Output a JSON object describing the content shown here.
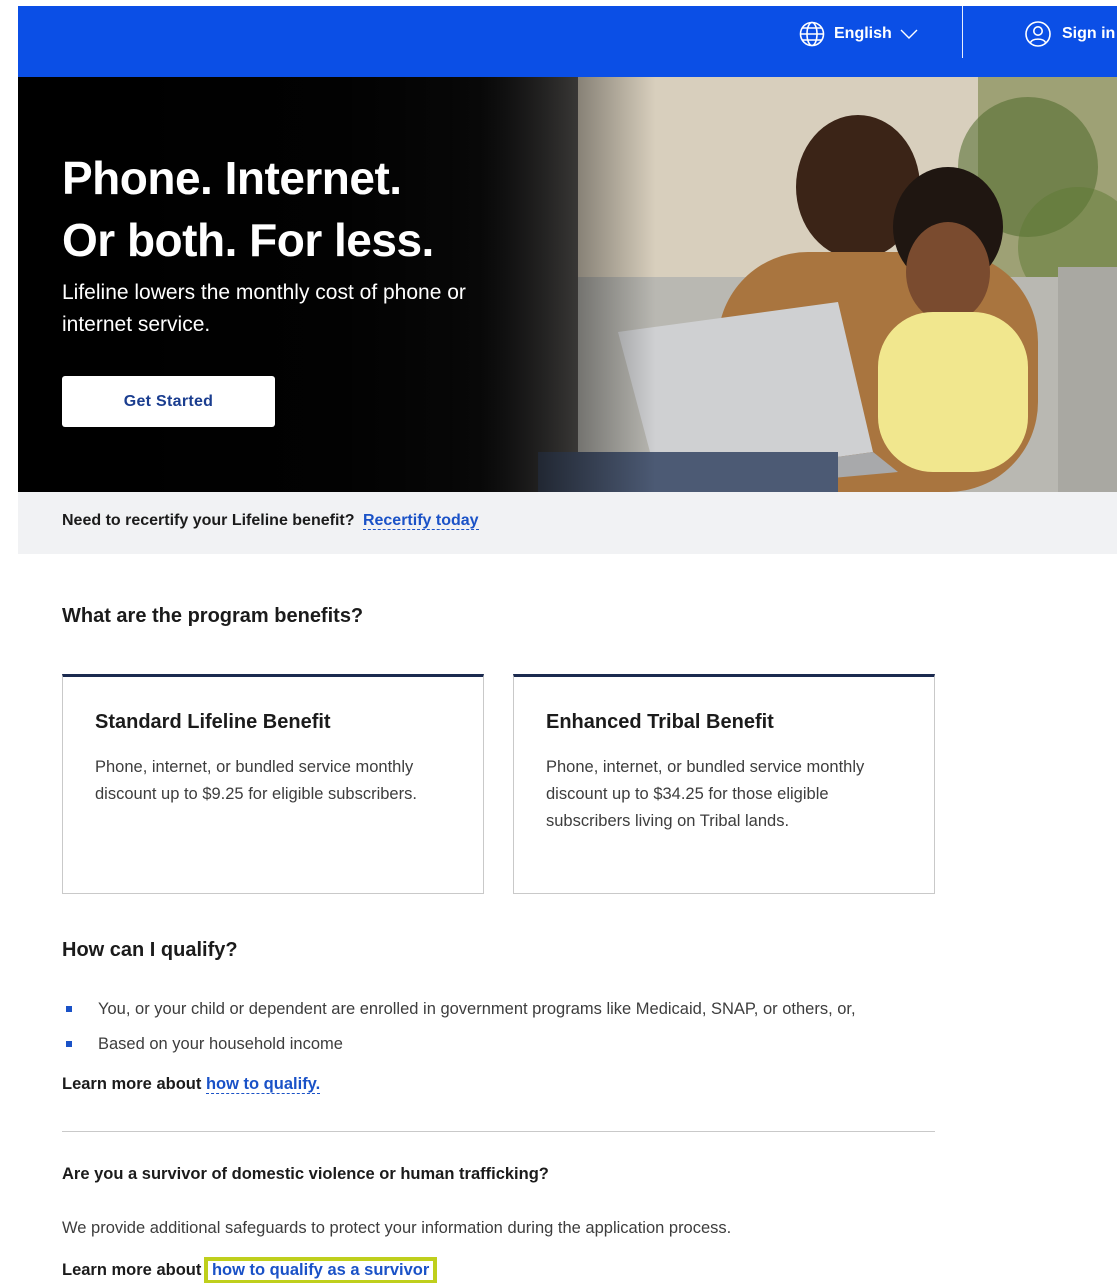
{
  "header": {
    "language_label": "English",
    "signin_label": "Sign in"
  },
  "hero": {
    "title_line1": "Phone. Internet.",
    "title_line2": "Or both. For less.",
    "subtitle": "Lifeline lowers the monthly cost of phone or internet service.",
    "cta_label": "Get Started"
  },
  "recertify": {
    "text": "Need to recertify your Lifeline benefit?",
    "link_label": "Recertify today"
  },
  "benefits": {
    "heading": "What are the program benefits?",
    "cards": [
      {
        "title": "Standard Lifeline Benefit",
        "body": "Phone, internet, or bundled service monthly discount up to $9.25 for eligible subscribers."
      },
      {
        "title": "Enhanced Tribal Benefit",
        "body": "Phone, internet, or bundled service monthly discount up to $34.25 for those eligible subscribers living on Tribal lands."
      }
    ]
  },
  "qualify": {
    "heading": "How can I qualify?",
    "items": [
      "You, or your child or dependent are enrolled in government programs like Medicaid, SNAP, or others, or,",
      "Based on your household income"
    ],
    "learn_prefix": "Learn more about",
    "learn_link": "how to qualify."
  },
  "survivor": {
    "heading": "Are you a survivor of domestic violence or human trafficking?",
    "body": "We provide additional safeguards to protect your information during the application process.",
    "learn_prefix": "Learn more about",
    "learn_link": "how to qualify as a survivor"
  },
  "colors": {
    "header_bg": "#0b4fe6",
    "link": "#1a52c7",
    "highlight": "#bfcf1c"
  }
}
